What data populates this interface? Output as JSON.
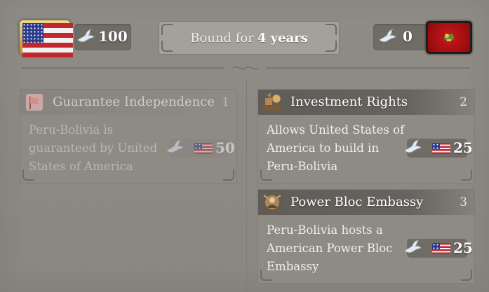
{
  "header": {
    "player_country": "United States",
    "player_influence": "100",
    "bound_prefix": "Bound for",
    "bound_value": "4 years",
    "target_influence": "0",
    "target_country": "Peru-Bolivia"
  },
  "colors": {
    "panel_bg": "#8e8b85",
    "header_bar": "#5f5c57",
    "text_light": "#f2efe6",
    "us_red": "#c1272d",
    "us_blue": "#2b3b8c",
    "target_red": "#b3151a"
  },
  "icons": {
    "influence": "dove-icon",
    "guarantee": "flag-icon",
    "investment": "investment-icon",
    "embassy": "embassy-icon"
  },
  "cards": [
    {
      "title": "Guarantee Independence",
      "number": "1",
      "description": "Peru-Bolivia is guaranteed by United States of America",
      "cost": "50",
      "dimmed": true
    },
    {
      "title": "Investment Rights",
      "number": "2",
      "description": "Allows United States of America to build in Peru-Bolivia",
      "cost": "25",
      "dimmed": false
    },
    {
      "title": "Power Bloc Embassy",
      "number": "3",
      "description": "Peru-Bolivia hosts a American Power Bloc Embassy",
      "cost": "25",
      "dimmed": false
    }
  ]
}
